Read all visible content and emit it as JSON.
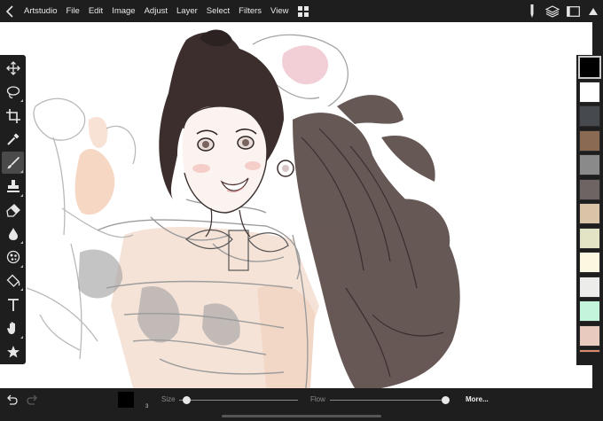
{
  "app": {
    "back_icon": "chevron-left-icon",
    "grid_icon": "grid-icon"
  },
  "menu": [
    {
      "label": "Artstudio"
    },
    {
      "label": "File"
    },
    {
      "label": "Edit"
    },
    {
      "label": "Image"
    },
    {
      "label": "Adjust"
    },
    {
      "label": "Layer"
    },
    {
      "label": "Select"
    },
    {
      "label": "Filters"
    },
    {
      "label": "View"
    }
  ],
  "header_right_icons": [
    "pencil-icon",
    "layers-icon",
    "fullscreen-icon",
    "hide-ui-icon"
  ],
  "tools": [
    {
      "name": "move-tool",
      "icon": "move-icon"
    },
    {
      "name": "lasso-tool",
      "icon": "lasso-icon",
      "submenu": true
    },
    {
      "name": "crop-tool",
      "icon": "crop-icon"
    },
    {
      "name": "eyedropper-tool",
      "icon": "eyedropper-icon"
    },
    {
      "name": "brush-tool",
      "icon": "brush-icon",
      "submenu": true,
      "active": true
    },
    {
      "name": "stamp-tool",
      "icon": "stamp-icon",
      "submenu": true
    },
    {
      "name": "eraser-tool",
      "icon": "eraser-icon"
    },
    {
      "name": "blur-tool",
      "icon": "drop-icon",
      "submenu": true
    },
    {
      "name": "smudge-tool",
      "icon": "smudge-icon",
      "submenu": true
    },
    {
      "name": "fill-tool",
      "icon": "bucket-icon",
      "submenu": true
    },
    {
      "name": "text-tool",
      "icon": "text-icon"
    },
    {
      "name": "hand-tool",
      "icon": "hand-icon",
      "submenu": true
    },
    {
      "name": "favorites-tool",
      "icon": "star-icon"
    }
  ],
  "palette": {
    "swatches": [
      "#000000",
      "#ffffff",
      "#46494e",
      "#8a6a52",
      "#8a8a8a",
      "#6e6464",
      "#d9c4a8",
      "#e3e3c5",
      "#fbf7e0",
      "#ececea",
      "#c2f5dc",
      "#e9cabf",
      "#d9896c"
    ],
    "selected_index": 0
  },
  "bottombar": {
    "undo_icon": "undo-icon",
    "redo_icon": "redo-icon",
    "brush_color": "#000000",
    "brush_size_number": "3",
    "size_label": "Size",
    "size_value": 0.06,
    "flow_label": "Flow",
    "flow_value": 1.0,
    "more_label": "More..."
  }
}
